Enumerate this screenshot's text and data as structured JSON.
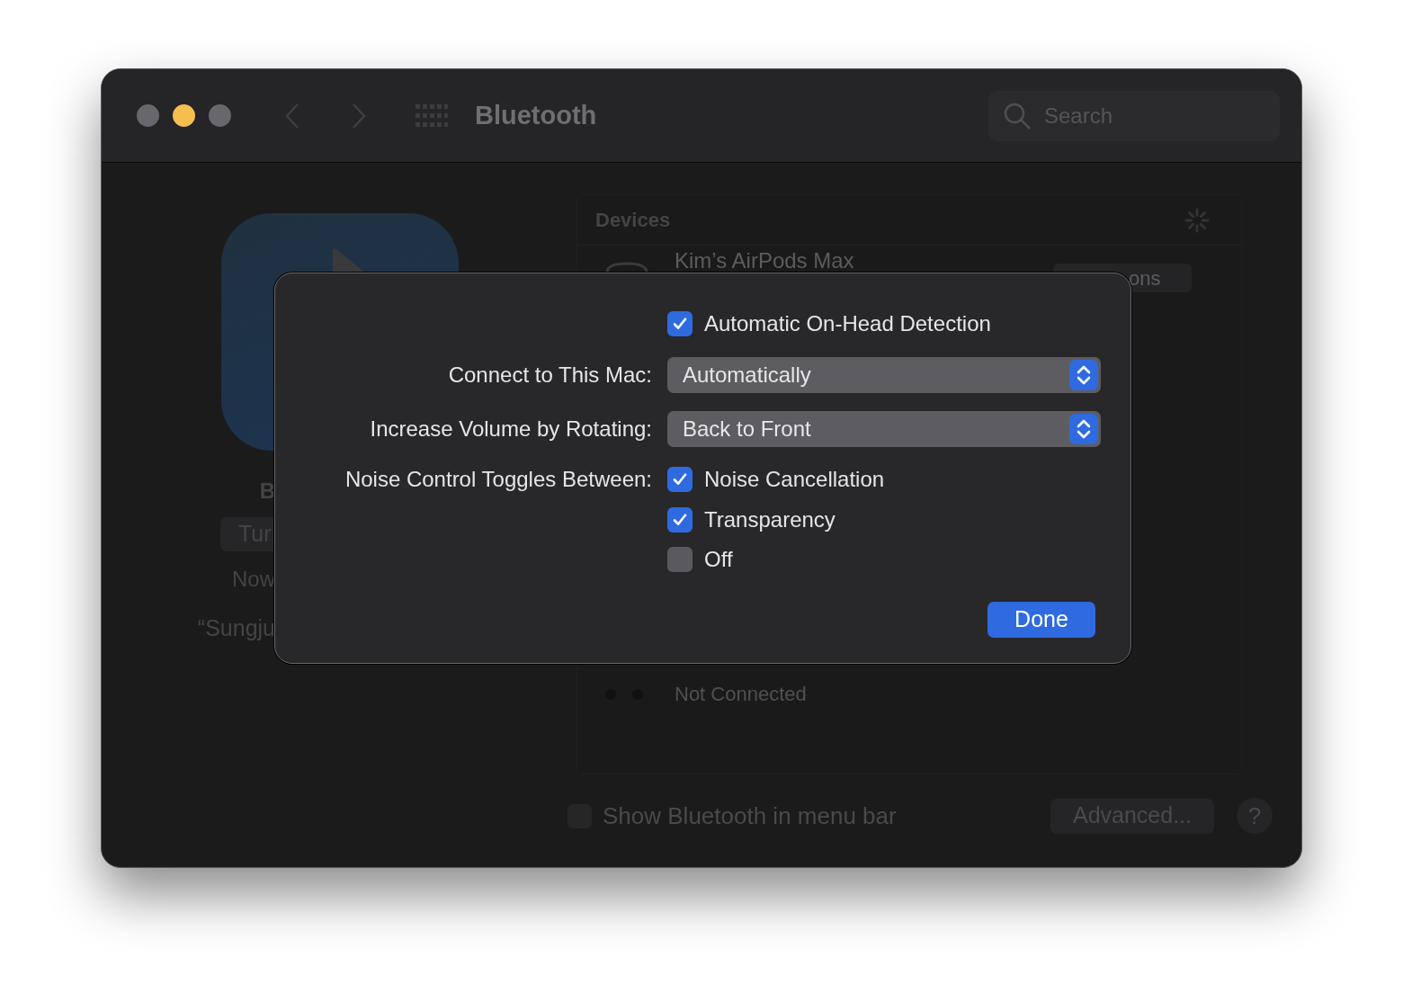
{
  "window": {
    "title": "Bluetooth",
    "search": {
      "placeholder": "Search"
    }
  },
  "left_panel": {
    "heading": "B",
    "button": "Tur",
    "status": "Now",
    "device_name": "“Sungju"
  },
  "devices": {
    "title": "Devices",
    "items": [
      {
        "name": "Kim’s AirPods Max",
        "button": "ons"
      },
      {
        "status": "Not Connected"
      }
    ]
  },
  "footer": {
    "menu_bar_option": {
      "label": "Show Bluetooth in menu bar",
      "checked": false
    },
    "advanced_button": "Advanced...",
    "help_button": "?"
  },
  "sheet": {
    "on_head_detection": {
      "label": "Automatic On-Head Detection",
      "checked": true
    },
    "popups": [
      {
        "label": "Connect to This Mac:",
        "value": "Automatically"
      },
      {
        "label": "Increase Volume by Rotating:",
        "value": "Back to Front"
      }
    ],
    "noise_control": {
      "label": "Noise Control Toggles Between:",
      "options": [
        {
          "label": "Noise Cancellation",
          "checked": true
        },
        {
          "label": "Transparency",
          "checked": true
        },
        {
          "label": "Off",
          "checked": false
        }
      ]
    },
    "done_button": "Done"
  }
}
